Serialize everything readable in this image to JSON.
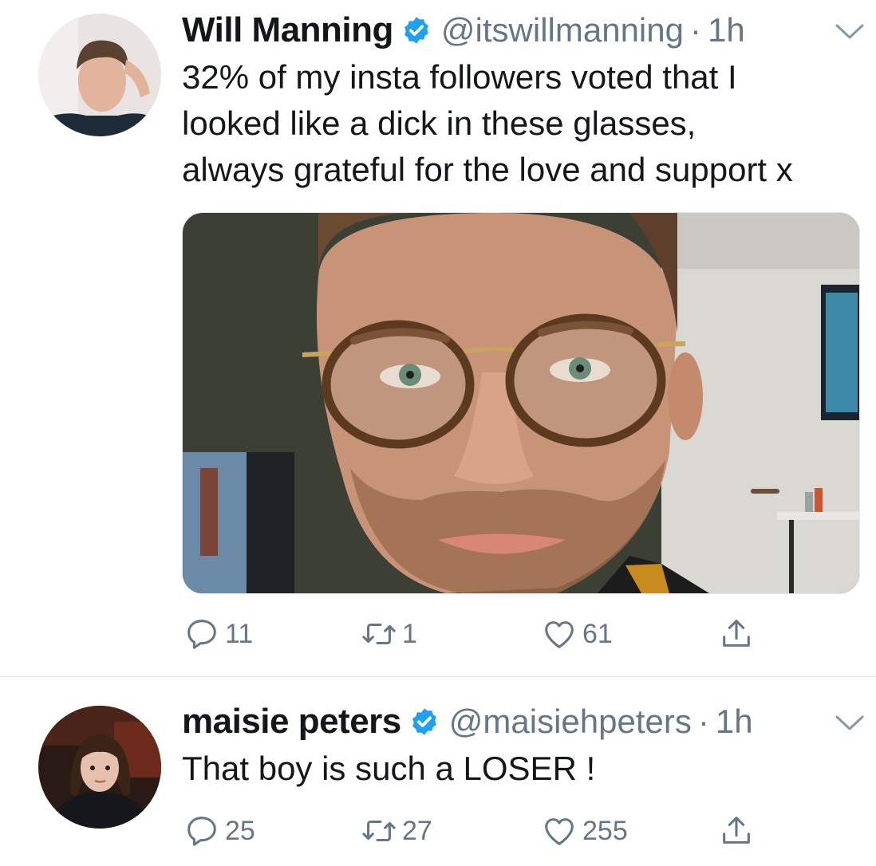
{
  "tweets": [
    {
      "author": {
        "name": "Will Manning",
        "handle": "@itswillmanning",
        "time": "1h"
      },
      "text_lines": [
        "32% of my insta followers voted that I",
        "looked like a dick in these glasses,",
        "always grateful for the love and support x"
      ],
      "actions": {
        "replies": "11",
        "retweets": "1",
        "likes": "61"
      }
    },
    {
      "author": {
        "name": "maisie peters",
        "handle": "@maisiehpeters",
        "time": "1h"
      },
      "text_lines": [
        "That boy is such a LOSER !"
      ],
      "actions": {
        "replies": "25",
        "retweets": "27",
        "likes": "255"
      }
    }
  ],
  "separator": "·",
  "icons": [
    "verified-badge-icon",
    "chevron-down-icon",
    "reply-icon",
    "retweet-icon",
    "like-icon",
    "share-icon"
  ],
  "colors": {
    "verified": "#1da1f2",
    "secondary_text": "#657786",
    "divider": "#e1e8ed"
  }
}
